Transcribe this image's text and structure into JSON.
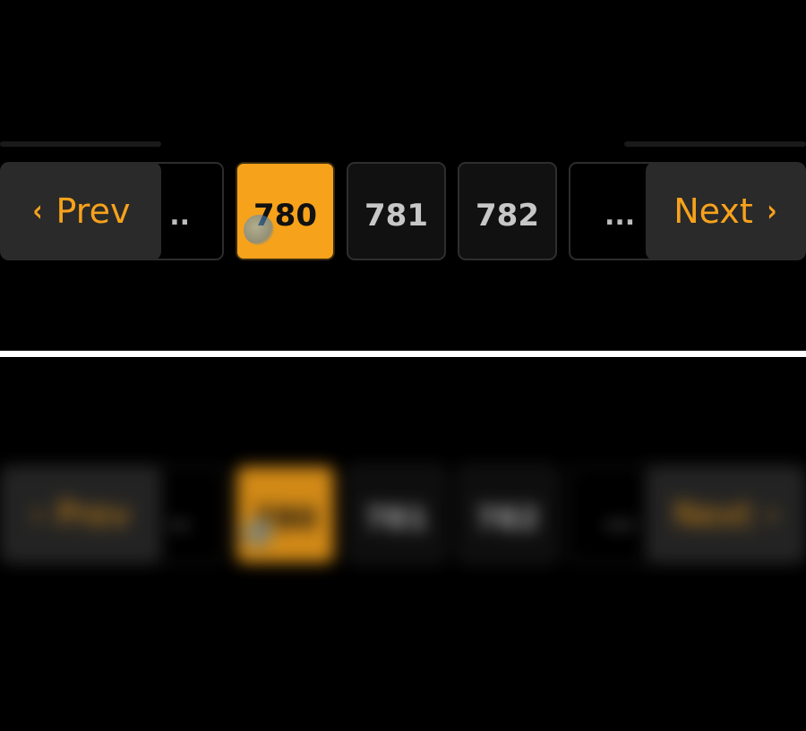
{
  "pagination": {
    "prev_label": "Prev",
    "next_label": "Next",
    "prev_icon": "chevron-left-icon",
    "next_icon": "chevron-right-icon",
    "prev_glyph": "‹",
    "next_glyph": "›",
    "ellipsis_left": "..",
    "ellipsis_right": "...",
    "pages": [
      "780",
      "781",
      "782"
    ],
    "current_page": "780"
  },
  "colors": {
    "background": "#000000",
    "accent": "#f7a21b",
    "button_bg": "#2a2a2a",
    "page_bg": "#111111",
    "page_text": "#c7c7c7",
    "divider": "#ffffff"
  }
}
